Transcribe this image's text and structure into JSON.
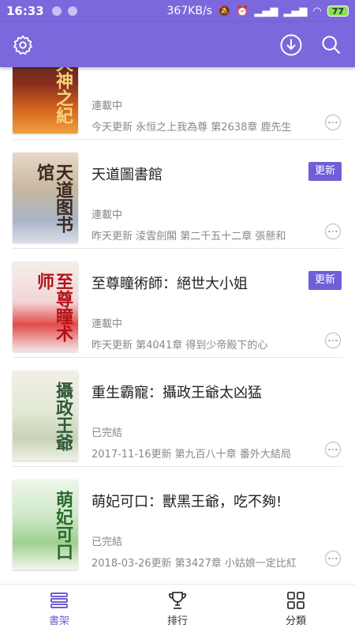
{
  "status_bar": {
    "time": "16:33",
    "network_speed": "367KB/s",
    "battery": "77"
  },
  "app_bar": {
    "icons": [
      "settings-icon",
      "download-icon",
      "search-icon"
    ],
    "accent_color": "#7a68dc"
  },
  "books": [
    {
      "title": "",
      "cover_text": "天神之紀",
      "status": "連載中",
      "update": "今天更新 永恒之上我為尊 第2638章 鹿先生",
      "has_update_badge": false
    },
    {
      "title": "天道圖書館",
      "cover_text": "天道图书馆",
      "status": "連載中",
      "update": "昨天更新 淩雲劍閣 第二千五十二章 張懸和",
      "has_update_badge": true,
      "badge": "更新"
    },
    {
      "title": "至尊瞳術師：絕世大小姐",
      "cover_text": "至尊瞳术师",
      "status": "連載中",
      "update": "昨天更新 第4041章 得到少帝殿下的心",
      "has_update_badge": true,
      "badge": "更新"
    },
    {
      "title": "重生霸寵：攝政王爺太凶猛",
      "cover_text": "攝政王爺",
      "status": "已完結",
      "update": "2017-11-16更新 第九百八十章 番外大結局",
      "has_update_badge": false
    },
    {
      "title": "萌妃可口：獸黑王爺，吃不夠!",
      "cover_text": "萌妃可口",
      "status": "已完結",
      "update": "2018-03-26更新 第3427章 小姑娘一定比紅",
      "has_update_badge": false
    }
  ],
  "bottom_nav": {
    "tabs": [
      {
        "label": "書架",
        "icon": "bookshelf-icon",
        "active": true
      },
      {
        "label": "排行",
        "icon": "trophy-icon",
        "active": false
      },
      {
        "label": "分類",
        "icon": "grid-icon",
        "active": false
      }
    ]
  }
}
